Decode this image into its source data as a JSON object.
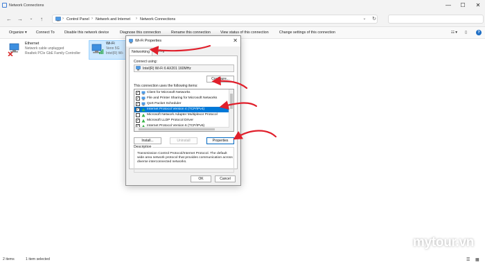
{
  "window": {
    "title": "Network Connections",
    "controls": [
      "—",
      "☐",
      "✕"
    ]
  },
  "nav": {
    "back": "←",
    "forward": "→",
    "dropdown": "⌄",
    "up": "↑"
  },
  "address": {
    "crumbs": [
      "Control Panel",
      "Network and Internet",
      "Network Connections"
    ],
    "refresh": "↻",
    "dropdown": "⌄"
  },
  "toolbar": {
    "organize": "Organize ▾",
    "connect_to": "Connect To",
    "disable": "Disable this network device",
    "diagnose": "Diagnose this connection",
    "rename": "Rename this connection",
    "view_status": "View status of this connection",
    "change_settings": "Change settings of this connection",
    "view_options": "☷ ▾",
    "preview": "▯",
    "help": "?"
  },
  "connections": [
    {
      "name": "Ethernet",
      "line1": "Network cable unplugged",
      "line2": "Realtek PCIe GbE Family Controller"
    },
    {
      "name": "Wi-Fi",
      "line1": "Venn 5G",
      "line2": "Intel(R) Wi-"
    }
  ],
  "dialog": {
    "title": "Wi-Fi Properties",
    "close": "✕",
    "tab_networking": "Networking",
    "tab_sharing": "Sharing",
    "connect_using_label": "Connect using:",
    "adapter": "Intel(R) Wi-Fi 6 AX201 160MHz",
    "configure": "Configure...",
    "items_label": "This connection uses the following items:",
    "items": [
      {
        "label": "Client for Microsoft Networks",
        "checked": true
      },
      {
        "label": "File and Printer Sharing for Microsoft Networks",
        "checked": true
      },
      {
        "label": "QoS Packet Scheduler",
        "checked": true
      },
      {
        "label": "Internet Protocol Version 4 (TCP/IPv4)",
        "checked": true,
        "selected": true
      },
      {
        "label": "Microsoft Network Adapter Multiplexor Protocol",
        "checked": false
      },
      {
        "label": "Microsoft LLDP Protocol Driver",
        "checked": true
      },
      {
        "label": "Internet Protocol Version 6 (TCP/IPv6)",
        "checked": true
      }
    ],
    "install": "Install...",
    "uninstall": "Uninstall",
    "properties": "Properties",
    "description_label": "Description",
    "description": "Transmission Control Protocol/Internet Protocol. The default wide area network protocol that provides communication across diverse interconnected networks.",
    "ok": "OK",
    "cancel": "Cancel"
  },
  "status": {
    "count": "2 items",
    "selected": "1 item selected"
  },
  "watermark": "mytour.vn",
  "colors": {
    "accent": "#0078d7",
    "arrow": "#e01f2b",
    "selection": "#cce8ff"
  }
}
